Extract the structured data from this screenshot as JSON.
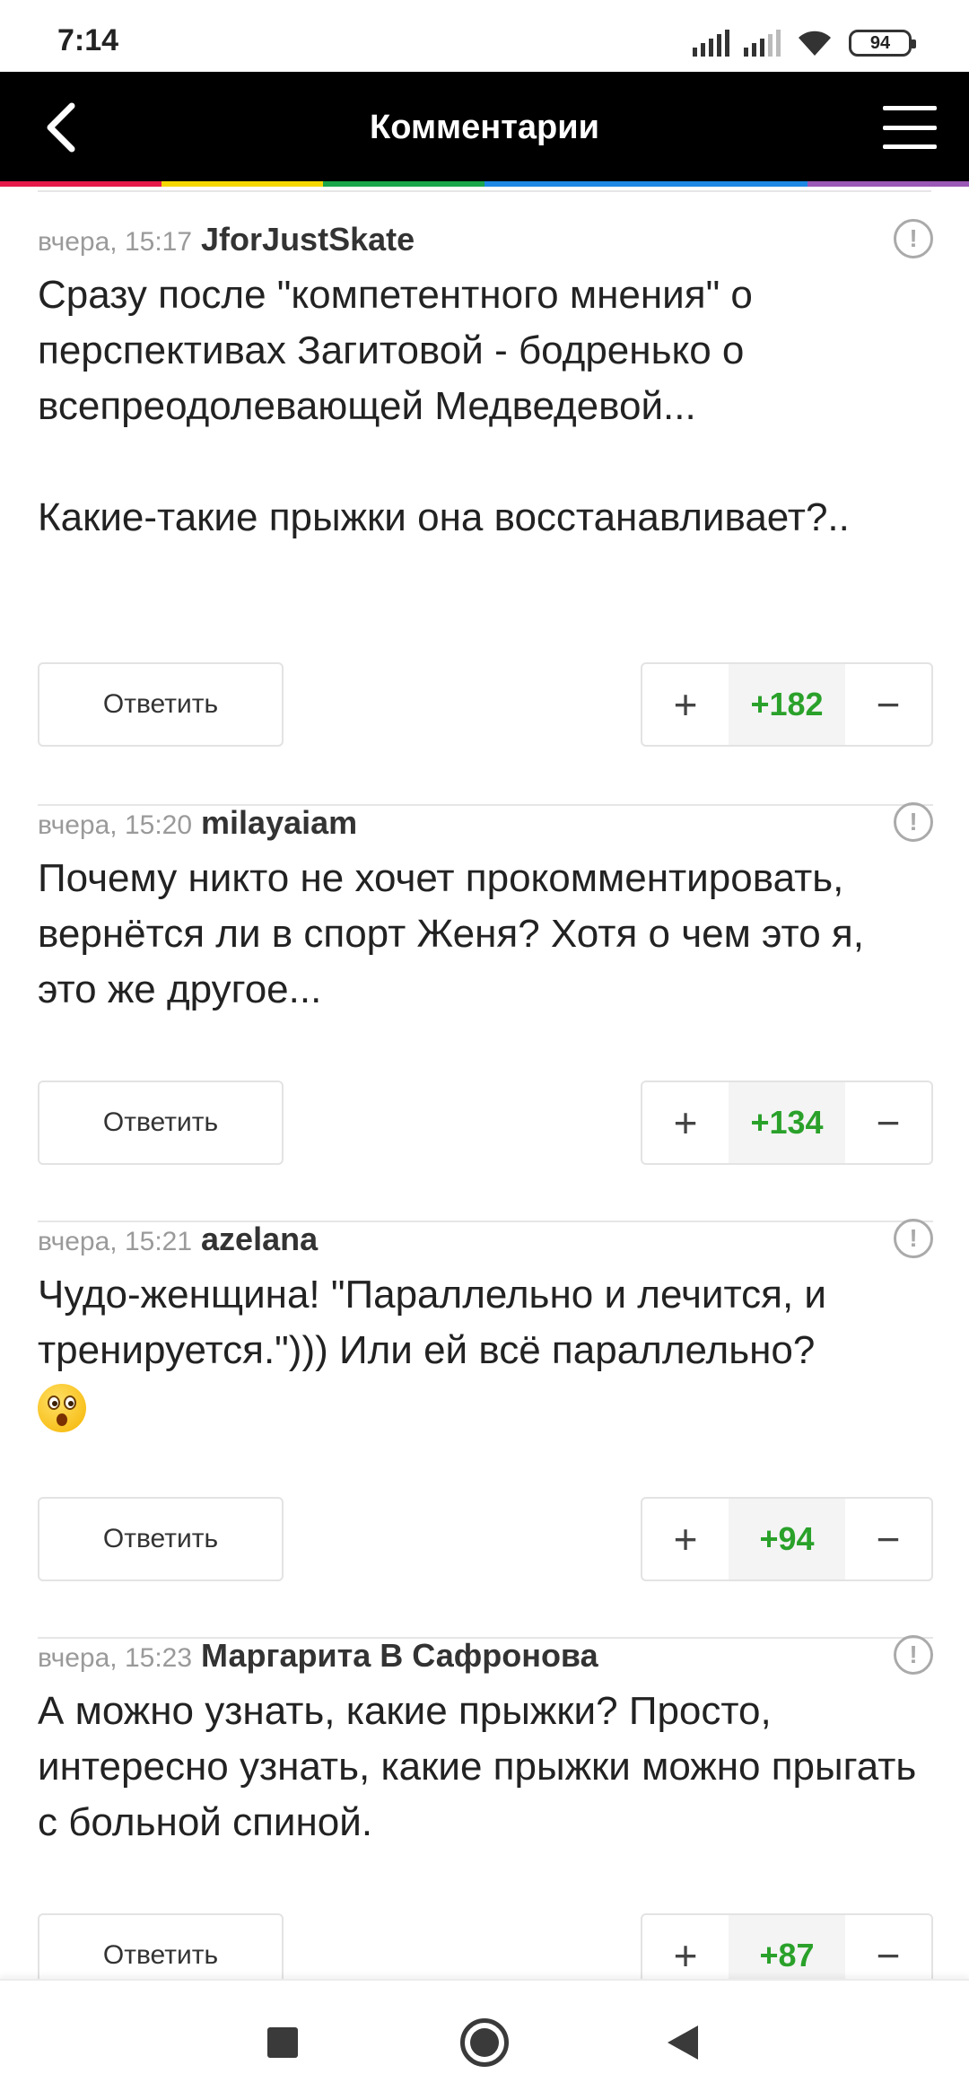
{
  "status_bar": {
    "time": "7:14",
    "battery": "94",
    "icons": [
      "signal-icon",
      "signal-weak-icon",
      "wifi-icon",
      "battery-icon"
    ]
  },
  "header": {
    "title": "Комментарии",
    "back_icon": "chevron-left-icon",
    "menu_icon": "hamburger-menu-icon",
    "accent_colors": [
      "#e6194b",
      "#f5d800",
      "#1aa64a",
      "#1e88e5",
      "#1e88e5",
      "#9b59b6"
    ]
  },
  "comments": [
    {
      "time": "вчера, 15:17",
      "author": "JforJustSkate",
      "text": "Сразу после \"компетентного мнения\" о перспективах Загитовой - бодренько о всепреодолевающей Медведевой...\n\nКакие-такие прыжки она восстанавливает?..",
      "reply_label": "Ответить",
      "score": "+182"
    },
    {
      "time": "вчера, 15:20",
      "author": "milayaiam",
      "text": "Почему никто не хочет прокомментировать, вернётся ли в спорт Женя? Хотя о чем это я, это же другое...",
      "reply_label": "Ответить",
      "score": "+134"
    },
    {
      "time": "вчера, 15:21",
      "author": "azelana",
      "text": "Чудо-женщина! \"Параллельно и лечится, и тренируется.\"))) Или ей всё параллельно?",
      "emoji": "flushed-face-emoji",
      "reply_label": "Ответить",
      "score": "+94"
    },
    {
      "time": "вчера, 15:23",
      "author": "Маргарита В Сафронова",
      "text": "А можно узнать, какие прыжки? Просто, интересно узнать, какие прыжки можно прыгать с больной спиной.",
      "reply_label": "Ответить",
      "score": "+87"
    }
  ],
  "vote": {
    "plus": "+",
    "minus": "−"
  },
  "nav_bar": {
    "icons": [
      "recents-square-icon",
      "home-circle-icon",
      "back-triangle-icon"
    ]
  },
  "colors": {
    "score_green": "#2aa12a",
    "header_bg": "#000000"
  }
}
